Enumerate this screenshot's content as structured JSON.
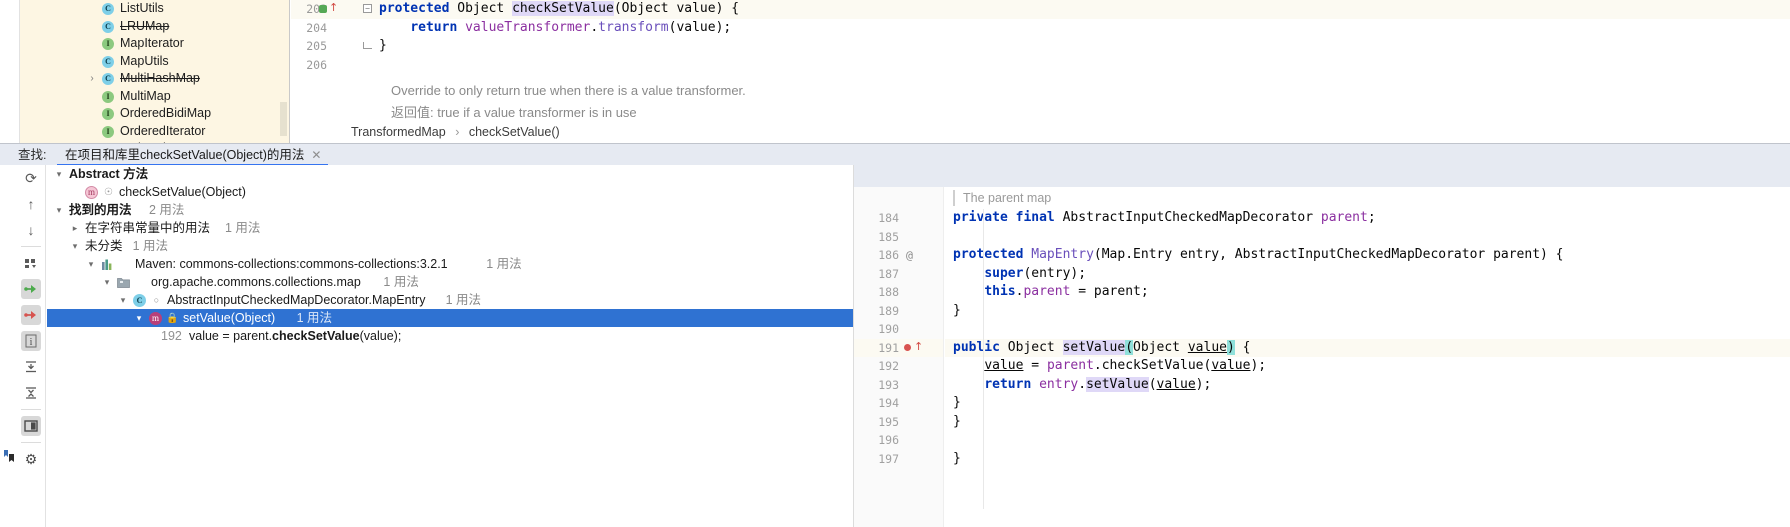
{
  "editor": {
    "project_tree": [
      {
        "label": "ListUtils",
        "icon": "class-icon",
        "kind": "c",
        "twisty": "",
        "struck": false
      },
      {
        "label": "LRUMap",
        "icon": "class-icon",
        "kind": "c",
        "twisty": "",
        "struck": true
      },
      {
        "label": "MapIterator",
        "icon": "interface-icon",
        "kind": "i",
        "twisty": "",
        "struck": false
      },
      {
        "label": "MapUtils",
        "icon": "class-icon",
        "kind": "c",
        "twisty": "",
        "struck": false
      },
      {
        "label": "MultiHashMap",
        "icon": "class-icon",
        "kind": "c",
        "twisty": "›",
        "struck": true
      },
      {
        "label": "MultiMap",
        "icon": "interface-icon",
        "kind": "i",
        "twisty": "",
        "struck": false
      },
      {
        "label": "OrderedBidiMap",
        "icon": "interface-icon",
        "kind": "i",
        "twisty": "",
        "struck": false
      },
      {
        "label": "OrderedIterator",
        "icon": "interface-icon",
        "kind": "i",
        "twisty": "",
        "struck": false
      },
      {
        "label": "OrderedMap",
        "icon": "interface-icon",
        "kind": "i",
        "twisty": "",
        "struck": false
      }
    ],
    "lines": [
      {
        "num": "203",
        "text": "protected Object checkSetValue(Object value) {",
        "highlight": true,
        "breakpoint": true,
        "fold": "open"
      },
      {
        "num": "204",
        "text": "    return valueTransformer.transform(value);",
        "highlight": false,
        "breakpoint": false,
        "fold": ""
      },
      {
        "num": "205",
        "text": "}",
        "highlight": false,
        "breakpoint": false,
        "fold": "end"
      },
      {
        "num": "206",
        "text": "",
        "highlight": false,
        "breakpoint": false,
        "fold": ""
      }
    ],
    "doc_line_1": "Override to only return true when there is a value transformer.",
    "doc_line_2_cn": "返回值:",
    "doc_line_2_en": " true if a value transformer is in use",
    "breadcrumb": {
      "class": "TransformedMap",
      "separator": "›",
      "method": "checkSetValue()"
    }
  },
  "find": {
    "label": "查找:",
    "tab_title": "在项目和库里heckSetValue(Object)的用法",
    "tab_title_full": "在项目和库里checkSetValue(Object)的用法",
    "close_glyph": "✕",
    "accent_color": "#3574f0",
    "selection_color": "#2f72d2",
    "toolbar": [
      {
        "name": "rerun-search-icon",
        "glyph": "⟳",
        "active": false
      },
      {
        "name": "previous-occurrence-icon",
        "glyph": "↑",
        "active": false
      },
      {
        "name": "next-occurrence-icon",
        "glyph": "↓",
        "active": false
      },
      {
        "name": "separator",
        "glyph": "",
        "active": false
      },
      {
        "name": "group-by-icon",
        "glyph": "∷",
        "active": false
      },
      {
        "name": "show-read-access-icon",
        "glyph": "⇥",
        "active": true
      },
      {
        "name": "show-write-access-icon",
        "glyph": "⇥",
        "active": true
      },
      {
        "name": "show-usage-info-icon",
        "glyph": "i",
        "active": true
      },
      {
        "name": "expand-all-icon",
        "glyph": "⤒",
        "active": false
      },
      {
        "name": "collapse-all-icon",
        "glyph": "⤓",
        "active": false
      },
      {
        "name": "separator",
        "glyph": "",
        "active": false
      },
      {
        "name": "preview-panel-icon",
        "glyph": "◨",
        "active": true
      },
      {
        "name": "separator",
        "glyph": "",
        "active": false
      },
      {
        "name": "settings-gear-icon",
        "glyph": "⚙",
        "active": false
      }
    ],
    "tree": [
      {
        "id": "abstract-method-group",
        "indent": 0,
        "twisty": "⌄",
        "icon": "",
        "label": "Abstract 方法",
        "bold": true,
        "count": "",
        "selected": false
      },
      {
        "id": "abstract-method-item",
        "indent": 1,
        "twisty": "",
        "icon": "method-icon",
        "label": "checkSetValue(Object)",
        "bold": false,
        "count": "",
        "selected": false
      },
      {
        "id": "found-usages-group",
        "indent": 0,
        "twisty": "⌄",
        "icon": "",
        "label": "找到的用法",
        "bold": true,
        "count": "2 用法",
        "selected": false
      },
      {
        "id": "usages-in-string-literals",
        "indent": 1,
        "twisty": "›",
        "icon": "",
        "label": "在字符串常量中的用法",
        "bold": false,
        "count": "1 用法",
        "selected": false
      },
      {
        "id": "unclassified-group",
        "indent": 1,
        "twisty": "⌄",
        "icon": "",
        "label": "未分类",
        "bold": false,
        "count": "1 用法",
        "selected": false
      },
      {
        "id": "maven-module",
        "indent": 2,
        "twisty": "⌄",
        "icon": "maven-icon",
        "label": "Maven: commons-collections:commons-collections:3.2.1",
        "bold": false,
        "count": "1 用法",
        "selected": false
      },
      {
        "id": "package-node",
        "indent": 3,
        "twisty": "⌄",
        "icon": "package-icon",
        "label": "org.apache.commons.collections.map",
        "bold": false,
        "count": "1 用法",
        "selected": false
      },
      {
        "id": "class-node",
        "indent": 4,
        "twisty": "⌄",
        "icon": "class-icon",
        "label": "AbstractInputCheckedMapDecorator.MapEntry",
        "bold": false,
        "count": "1 用法",
        "selected": false
      },
      {
        "id": "method-node",
        "indent": 5,
        "twisty": "⌄",
        "icon": "method-filled-icon",
        "label": "setValue(Object)",
        "bold": false,
        "count": "1 用法",
        "selected": true
      },
      {
        "id": "usage-line",
        "indent": 6,
        "twisty": "",
        "icon": "",
        "label": "",
        "bold": false,
        "count": "",
        "selected": false,
        "snippet": {
          "line_number": "192",
          "pre": "value = parent.",
          "match": "checkSetValue",
          "post": "(value);"
        }
      }
    ]
  },
  "preview": {
    "doc_comment": "The parent map",
    "lines": [
      {
        "num": "184",
        "at": "",
        "highlight": false,
        "breakpoint": false,
        "tokens": [
          {
            "t": "private ",
            "c": "kw"
          },
          {
            "t": "final ",
            "c": "kw"
          },
          {
            "t": "AbstractInputCheckedMapDecorator ",
            "c": ""
          },
          {
            "t": "parent",
            "c": "fld"
          },
          {
            "t": ";",
            "c": ""
          }
        ]
      },
      {
        "num": "185",
        "at": "",
        "highlight": false,
        "breakpoint": false,
        "tokens": []
      },
      {
        "num": "186",
        "at": "@",
        "highlight": false,
        "breakpoint": false,
        "tokens": [
          {
            "t": "protected ",
            "c": "kw"
          },
          {
            "t": "MapEntry",
            "c": "mname"
          },
          {
            "t": "(Map.Entry entry, AbstractInputCheckedMapDecorator parent) {",
            "c": ""
          }
        ]
      },
      {
        "num": "187",
        "at": "",
        "highlight": false,
        "breakpoint": false,
        "tokens": [
          {
            "t": "    ",
            "c": ""
          },
          {
            "t": "super",
            "c": "kw"
          },
          {
            "t": "(entry);",
            "c": ""
          }
        ]
      },
      {
        "num": "188",
        "at": "",
        "highlight": false,
        "breakpoint": false,
        "tokens": [
          {
            "t": "    ",
            "c": ""
          },
          {
            "t": "this",
            "c": "kw"
          },
          {
            "t": ".",
            "c": ""
          },
          {
            "t": "parent",
            "c": "fld"
          },
          {
            "t": " = parent;",
            "c": ""
          }
        ]
      },
      {
        "num": "189",
        "at": "",
        "highlight": false,
        "breakpoint": false,
        "tokens": [
          {
            "t": "}",
            "c": ""
          }
        ]
      },
      {
        "num": "190",
        "at": "",
        "highlight": false,
        "breakpoint": false,
        "tokens": []
      },
      {
        "num": "191",
        "at": "",
        "highlight": true,
        "breakpoint": true,
        "tokens": [
          {
            "t": "public ",
            "c": "kw"
          },
          {
            "t": "Object ",
            "c": ""
          },
          {
            "t": "setValue",
            "c": "hl-ident"
          },
          {
            "t": "(",
            "c": "teal"
          },
          {
            "t": "Object ",
            "c": ""
          },
          {
            "t": "value",
            "c": "und"
          },
          {
            "t": ")",
            "c": "teal"
          },
          {
            "t": " {",
            "c": ""
          }
        ]
      },
      {
        "num": "192",
        "at": "",
        "highlight": false,
        "breakpoint": false,
        "tokens": [
          {
            "t": "    ",
            "c": ""
          },
          {
            "t": "value",
            "c": "und"
          },
          {
            "t": " = ",
            "c": ""
          },
          {
            "t": "parent",
            "c": "fld"
          },
          {
            "t": ".checkSetValue(",
            "c": ""
          },
          {
            "t": "value",
            "c": "und"
          },
          {
            "t": ");",
            "c": ""
          }
        ]
      },
      {
        "num": "193",
        "at": "",
        "highlight": false,
        "breakpoint": false,
        "tokens": [
          {
            "t": "    ",
            "c": ""
          },
          {
            "t": "return ",
            "c": "kw"
          },
          {
            "t": "entry",
            "c": "fld"
          },
          {
            "t": ".",
            "c": ""
          },
          {
            "t": "setValue",
            "c": "hl-ident"
          },
          {
            "t": "(",
            "c": ""
          },
          {
            "t": "value",
            "c": "und"
          },
          {
            "t": ");",
            "c": ""
          }
        ]
      },
      {
        "num": "194",
        "at": "",
        "highlight": false,
        "breakpoint": false,
        "tokens": [
          {
            "t": "}",
            "c": ""
          }
        ]
      },
      {
        "num": "195",
        "at": "",
        "highlight": false,
        "breakpoint": false,
        "tokens": [
          {
            "t": "}",
            "c": ""
          }
        ]
      },
      {
        "num": "196",
        "at": "",
        "highlight": false,
        "breakpoint": false,
        "tokens": []
      },
      {
        "num": "197",
        "at": "",
        "highlight": false,
        "breakpoint": false,
        "tokens": [
          {
            "t": "}",
            "c": ""
          }
        ]
      }
    ]
  },
  "status": {
    "corner_icon": "bookmark-icon"
  }
}
